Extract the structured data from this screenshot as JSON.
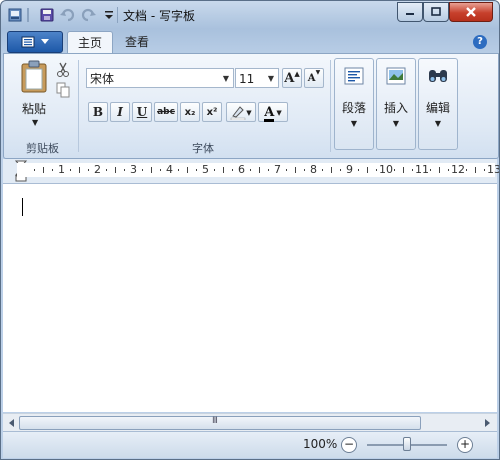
{
  "window": {
    "title": "文档 - 写字板"
  },
  "tabs": [
    {
      "label": "主页",
      "active": true
    },
    {
      "label": "查看",
      "active": false
    }
  ],
  "ribbon": {
    "clipboard": {
      "paste_label": "粘贴",
      "group_label": "剪贴板"
    },
    "font": {
      "font_name": "宋体",
      "font_size": "11",
      "grow_label": "A",
      "shrink_label": "A",
      "bold": "B",
      "italic": "I",
      "underline": "U",
      "strike": "abc",
      "subscript": "x₂",
      "superscript": "x²",
      "font_color": "A",
      "group_label": "字体"
    },
    "paragraph_label": "段落",
    "insert_label": "插入",
    "edit_label": "编辑"
  },
  "ruler": {
    "numbers": [
      "1",
      "2",
      "3",
      "4",
      "5",
      "6",
      "7",
      "8",
      "9",
      "10",
      "11",
      "12",
      "13"
    ]
  },
  "scrollbar": {
    "grip": "III"
  },
  "status": {
    "zoom": "100%",
    "zoom_out": "−",
    "zoom_in": "+"
  },
  "colors": {
    "accent": "#1d58a8",
    "font_color_bar": "#000000",
    "highlight_bar": "#ffffff"
  }
}
